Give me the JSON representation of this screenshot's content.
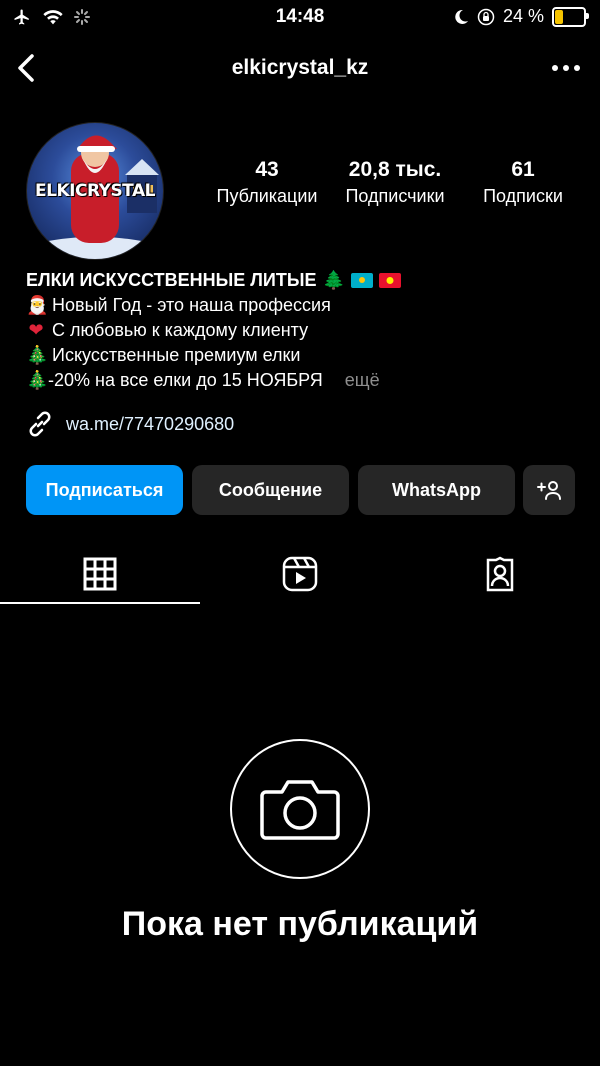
{
  "status_bar": {
    "time": "14:48",
    "battery": "24 %"
  },
  "header": {
    "username": "elkicrystal_kz"
  },
  "avatar": {
    "text": "ELKICRYSTAL"
  },
  "stats": [
    {
      "value": "43",
      "label": "Публикации"
    },
    {
      "value": "20,8 тыс.",
      "label": "Подписчики"
    },
    {
      "value": "61",
      "label": "Подписки"
    }
  ],
  "bio": {
    "title": "ЕЛКИ ИСКУССТВЕННЫЕ ЛИТЫЕ",
    "lines": [
      "Новый Год - это наша профессия",
      "С любовью к каждому клиенту",
      "Искусственные премиум елки",
      "-20% на все елки до 15 НОЯБРЯ"
    ],
    "more": "ещё",
    "link": "wa.me/77470290680"
  },
  "buttons": {
    "follow": "Подписаться",
    "message": "Сообщение",
    "whatsapp": "WhatsApp"
  },
  "empty_state": {
    "text": "Пока нет публикаций"
  },
  "colors": {
    "accent": "#0095f6",
    "button_bg": "#262626",
    "battery": "#f5c400"
  }
}
